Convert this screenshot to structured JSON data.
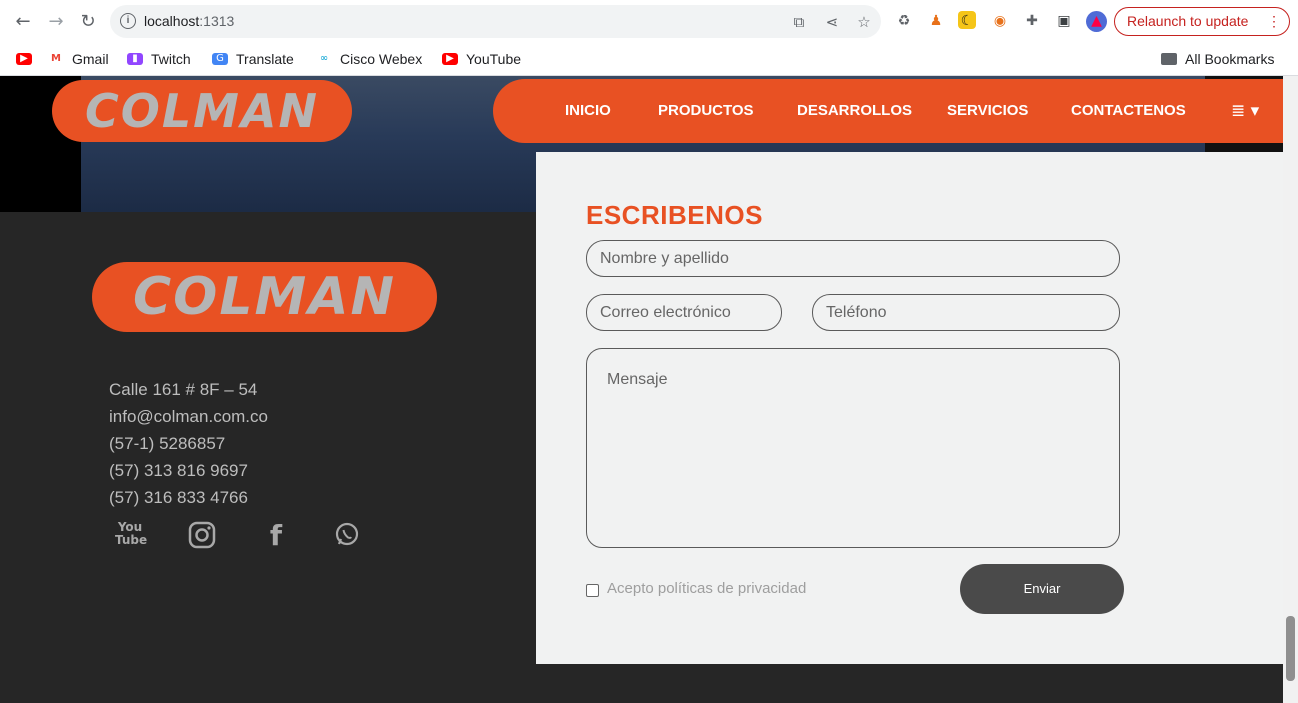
{
  "browser": {
    "url_host": "localhost",
    "url_port": ":1313",
    "relaunch_label": "Relaunch to update",
    "bookmarks": [
      "Gmail",
      "Twitch",
      "Translate",
      "Cisco Webex",
      "YouTube"
    ],
    "all_bookmarks_label": "All Bookmarks"
  },
  "site": {
    "logo_text": "COLMAN",
    "nav": [
      "INICIO",
      "PRODUCTOS",
      "DESARROLLOS",
      "SERVICIOS",
      "CONTACTENOS"
    ],
    "nav_menu_icon": "≣ ▾",
    "contact": {
      "address": "Calle 161 # 8F – 54",
      "email": "info@colman.com.co",
      "phone1": "(57-1) 5286857",
      "phone2": "(57) 313 816 9697",
      "phone3": "(57) 316 833 4766"
    },
    "social_icons": [
      "youtube-icon",
      "instagram-icon",
      "facebook-icon",
      "whatsapp-icon"
    ]
  },
  "form": {
    "title": "ESCRIBENOS",
    "name_placeholder": "Nombre y apellido",
    "email_placeholder": "Correo electrónico",
    "phone_placeholder": "Teléfono",
    "message_placeholder": "Mensaje",
    "privacy_label": "Acepto políticas de privacidad",
    "send_label": "Enviar"
  },
  "colors": {
    "brand_orange": "#e85123",
    "footer_bg": "#262626",
    "form_bg": "#f1f2f2"
  }
}
